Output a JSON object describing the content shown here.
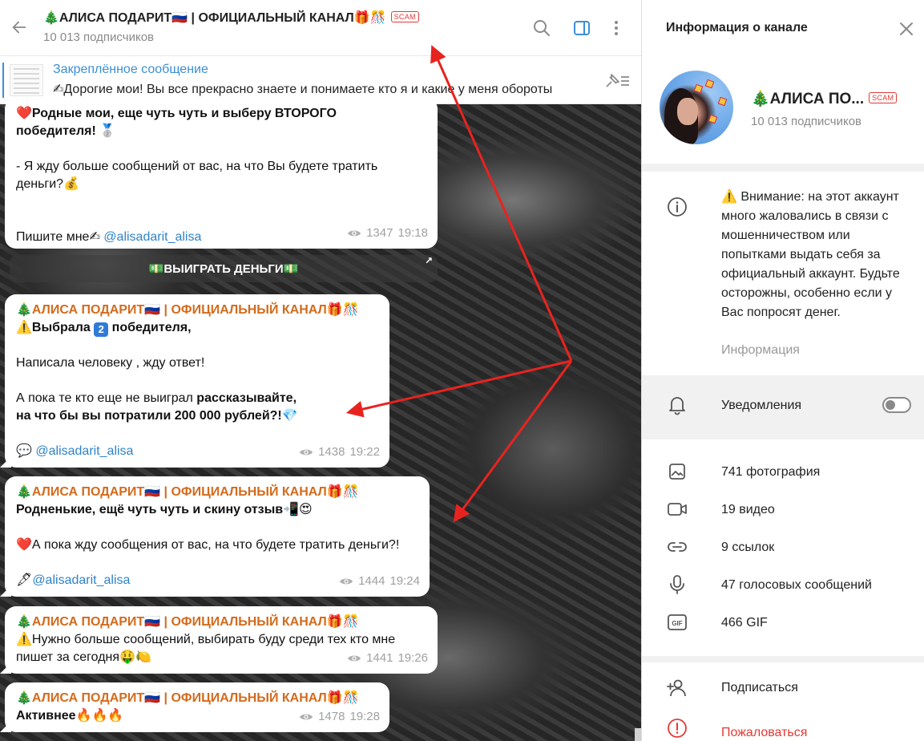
{
  "header": {
    "title_pre": "🎄АЛИСА ПОДАРИТ🇷🇺 | ОФИЦИАЛЬНЫЙ КАНАЛ🎁🎊",
    "scam_badge": "SCAM",
    "subscribers": "10 013 подписчиков"
  },
  "pinned": {
    "title": "Закреплённое сообщение",
    "text": "✍Дорогие мои! Вы все прекрасно знаете и понимаете кто я и какие у меня обороты"
  },
  "messages": [
    {
      "line1": "❤️Родные мои, еще чуть чуть и выберу ВТОРОГО",
      "line2": "победителя! 🥈",
      "line3": "- Я жду больше сообщений от вас, на что Вы будете тратить",
      "line4": "деньги?💰",
      "line5_prefix": "Пишите мне✍ ",
      "mention": "@alisadarit_alisa",
      "views": "1347",
      "time": "19:18"
    },
    {
      "author": "🎄АЛИСА ПОДАРИТ🇷🇺 | ОФИЦИАЛЬНЫЙ КАНАЛ🎁🎊",
      "line1_a": "⚠️Выбрала ",
      "line1_chip": "2",
      "line1_b": " победителя,",
      "line2": "Написала человеку , жду ответ!",
      "line3_a": " А пока те кто еще не выиграл ",
      "line3_b": "рассказывайте,",
      "line4": "на что бы вы потратили 200 000 рублей?!💎",
      "line5_prefix": "💬 ",
      "mention": "@alisadarit_alisa",
      "views": "1438",
      "time": "19:22"
    },
    {
      "author": "🎄АЛИСА ПОДАРИТ🇷🇺 | ОФИЦИАЛЬНЫЙ КАНАЛ🎁🎊",
      "line1": "Родненькие, ещё чуть чуть и скину отзыв📲😍",
      "line2": "❤️А пока жду сообщения от вас, на что будете тратить деньги?!",
      "line3_prefix": "🖋",
      "mention": "@alisadarit_alisa",
      "views": "1444",
      "time": "19:24"
    },
    {
      "author": "🎄АЛИСА ПОДАРИТ🇷🇺 | ОФИЦИАЛЬНЫЙ КАНАЛ🎁🎊",
      "line1": "⚠️Нужно больше сообщений, выбирать буду среди тех кто мне",
      "line2": "пишет за сегодня🤑🍋",
      "views": "1441",
      "time": "19:26"
    },
    {
      "author": "🎄АЛИСА ПОДАРИТ🇷🇺 | ОФИЦИАЛЬНЫЙ КАНАЛ🎁🎊",
      "line1": "Активнее🔥🔥🔥",
      "views": "1478",
      "time": "19:28"
    }
  ],
  "win_button": "💵ВЫИГРАТЬ ДЕНЬГИ💵",
  "side": {
    "heading": "Информация о канале",
    "name": "🎄АЛИСА ПО...",
    "scam_badge": "SCAM",
    "subscribers": "10 013 подписчиков",
    "warning": "⚠️ Внимание: на этот аккаунт много жаловались в связи с мошенничеством или попытками выдать себя за официальный аккаунт. Будьте осторожны, особенно если у Вас попросят денег.",
    "warning_caption": "Информация",
    "notifications": "Уведомления",
    "media": {
      "photos": "741 фотография",
      "videos": "19 видео",
      "links": "9 ссылок",
      "voice": "47 голосовых сообщений",
      "gif": "466 GIF"
    },
    "subscribe": "Подписаться",
    "report": "Пожаловаться",
    "gif_icon_label": "GIF"
  },
  "icons": {
    "back": "arrow-left-icon",
    "search": "search-icon",
    "sidebar": "sidebar-toggle-icon",
    "more": "more-vertical-icon",
    "unpin": "unpin-icon",
    "close": "close-icon",
    "info": "info-icon",
    "bell": "bell-icon",
    "photo": "photo-icon",
    "video": "video-icon",
    "link": "link-icon",
    "mic": "mic-icon",
    "gif": "gif-icon",
    "add_user": "add-user-icon",
    "report": "report-icon",
    "eye": "eye-icon"
  },
  "colors": {
    "accent": "#3b8fd6",
    "author": "#d36b1c",
    "scam": "#e53935",
    "annotation_arrow": "#e8231f"
  }
}
